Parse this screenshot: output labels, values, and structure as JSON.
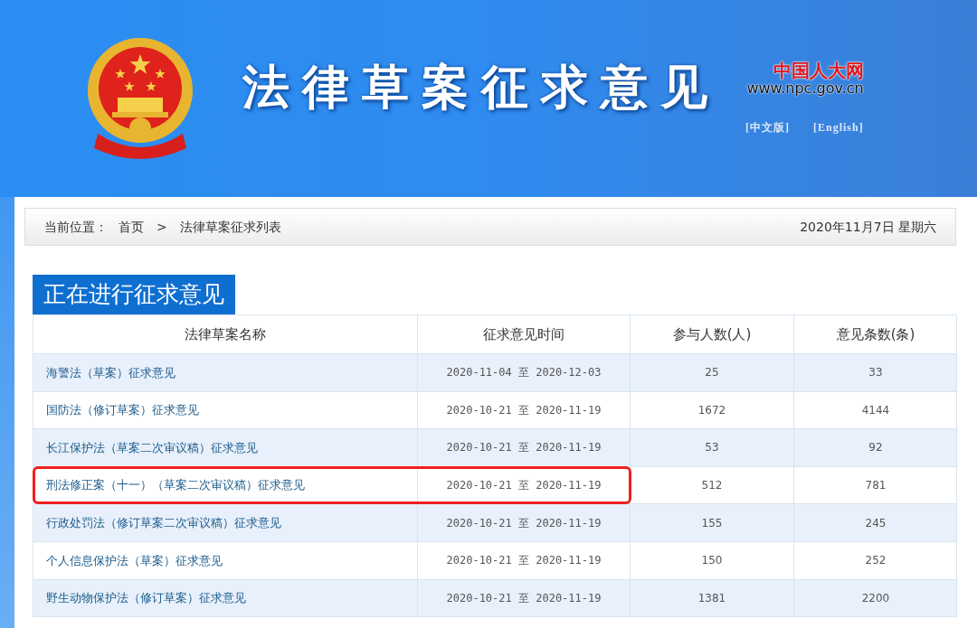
{
  "header": {
    "title": "法律草案征求意见",
    "site_name": "中国人大网",
    "site_url": "www.npc.gov.cn",
    "language_links": [
      "[中文版]",
      "[English]"
    ]
  },
  "breadcrumb": {
    "label": "当前位置：",
    "items": [
      "首页",
      "法律草案征求列表"
    ],
    "separator": ">",
    "date": "2020年11月7日  星期六"
  },
  "section_title": "正在进行征求意见",
  "table": {
    "columns": [
      "法律草案名称",
      "征求意见时间",
      "参与人数(人)",
      "意见条数(条)"
    ],
    "rows": [
      {
        "name": "海警法（草案）征求意见",
        "period": "2020-11-04 至 2020-12-03",
        "participants": "25",
        "comments": "33",
        "highlighted": false
      },
      {
        "name": "国防法（修订草案）征求意见",
        "period": "2020-10-21 至 2020-11-19",
        "participants": "1672",
        "comments": "4144",
        "highlighted": false
      },
      {
        "name": "长江保护法（草案二次审议稿）征求意见",
        "period": "2020-10-21 至 2020-11-19",
        "participants": "53",
        "comments": "92",
        "highlighted": false
      },
      {
        "name": "刑法修正案（十一）（草案二次审议稿）征求意见",
        "period": "2020-10-21 至 2020-11-19",
        "participants": "512",
        "comments": "781",
        "highlighted": true
      },
      {
        "name": "行政处罚法（修订草案二次审议稿）征求意见",
        "period": "2020-10-21 至 2020-11-19",
        "participants": "155",
        "comments": "245",
        "highlighted": false
      },
      {
        "name": "个人信息保护法（草案）征求意见",
        "period": "2020-10-21 至 2020-11-19",
        "participants": "150",
        "comments": "252",
        "highlighted": false
      },
      {
        "name": "野生动物保护法（修订草案）征求意见",
        "period": "2020-10-21 至 2020-11-19",
        "participants": "1381",
        "comments": "2200",
        "highlighted": false
      }
    ]
  }
}
